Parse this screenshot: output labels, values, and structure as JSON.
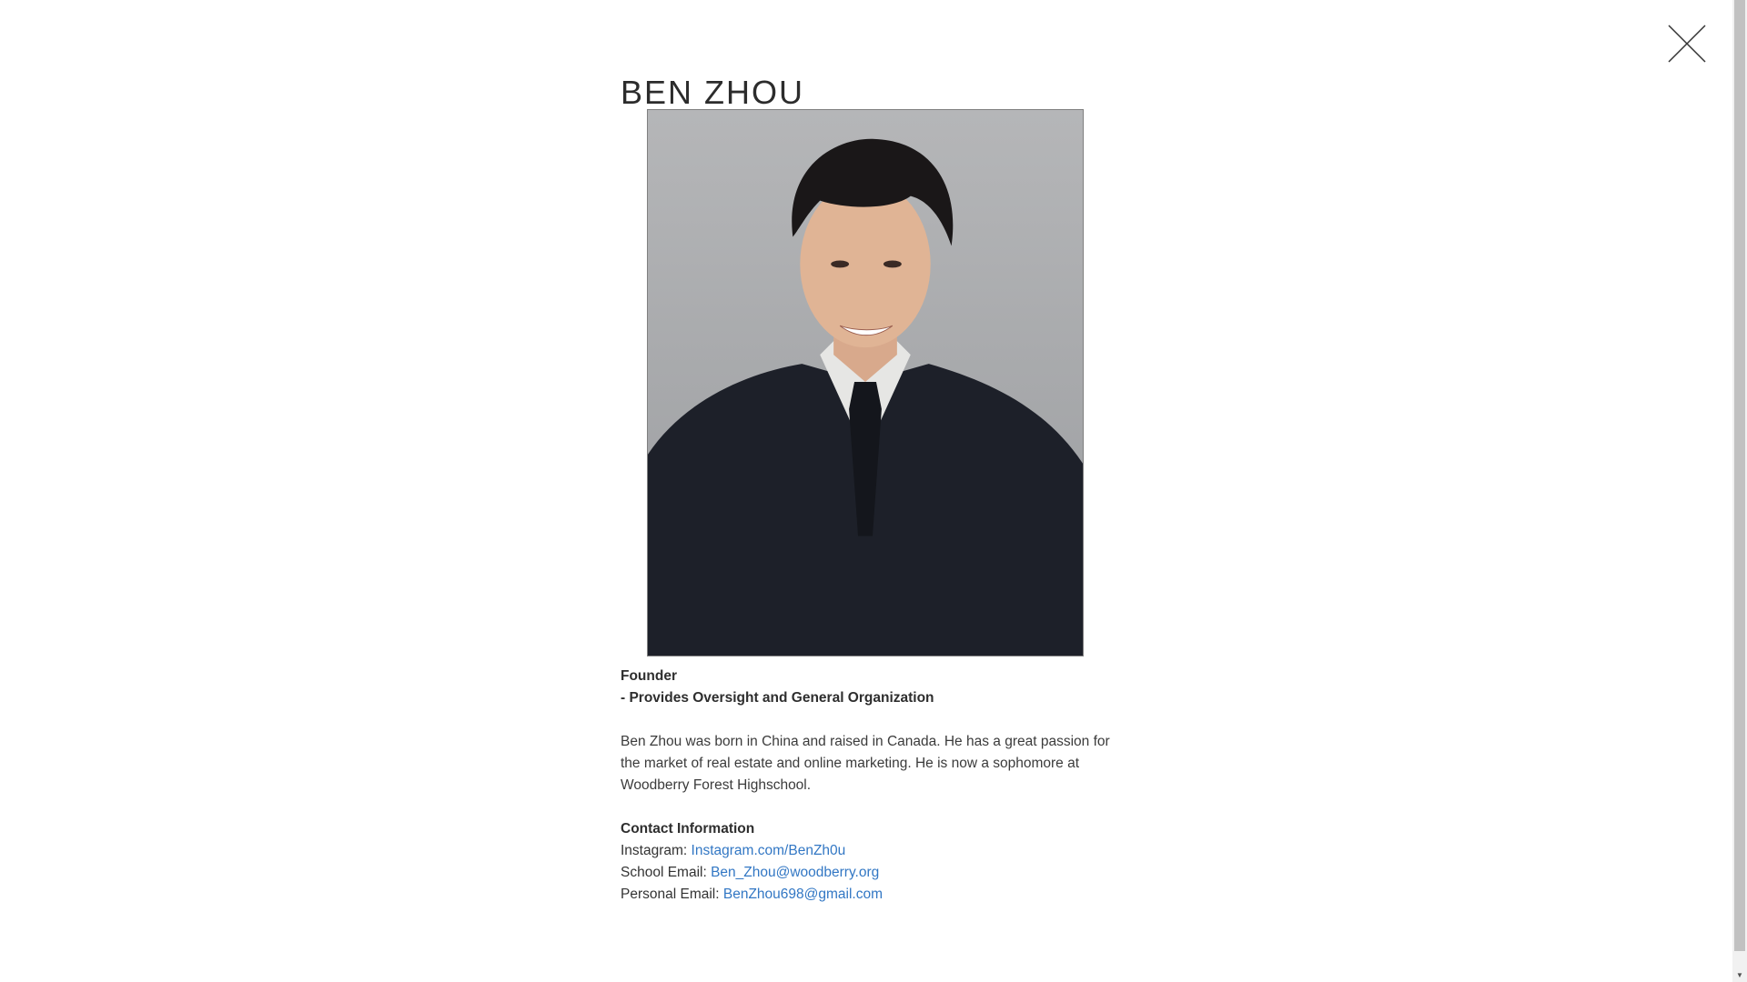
{
  "close": {
    "icon": "close-icon"
  },
  "profile": {
    "name": "BEN ZHOU",
    "photo_icon": "portrait-photo",
    "role": "Founder",
    "duty": "- Provides Oversight and General Organization",
    "bio": "Ben Zhou was born in China and raised in Canada. He has a great passion for the market of real estate and online marketing. He is now a sophomore at Woodberry Forest Highschool."
  },
  "contact": {
    "heading": "Contact Information",
    "instagram_label": "Instagram:",
    "instagram_link": "Instagram.com/BenZh0u",
    "school_label": "School Email:",
    "school_link": "Ben_Zhou@woodberry.org",
    "personal_label": "Personal Email:",
    "personal_link": "BenZhou698@gmail.com"
  },
  "colors": {
    "link": "#3277c4",
    "text": "#333333",
    "background": "#ffffff"
  }
}
